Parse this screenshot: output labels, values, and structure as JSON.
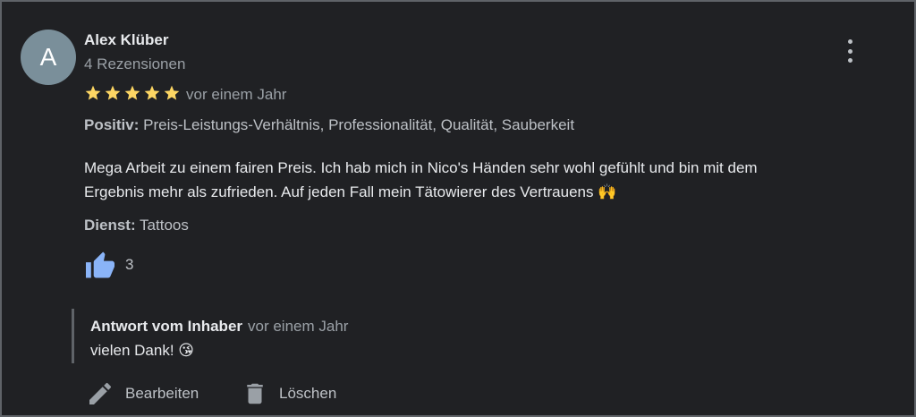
{
  "review": {
    "avatar_letter": "A",
    "author_name": "Alex Klüber",
    "author_reviews": "4 Rezensionen",
    "rating": 5,
    "rating_max": 5,
    "time": "vor einem Jahr",
    "positive_label": "Positiv:",
    "positive_text": "Preis-Leistungs-Verhältnis, Professionalität, Qualität, Sauberkeit",
    "text_line1": "Mega Arbeit zu einem fairen Preis. Ich hab mich in Nico's Händen sehr wohl gefühlt und bin mit dem",
    "text_line2": "Ergebnis mehr als zufrieden. Auf jeden Fall mein Tätowierer des Vertrauens",
    "text_emoji": "🙌",
    "service_label": "Dienst:",
    "service_value": "Tattoos",
    "likes": "3",
    "colors": {
      "background": "#202124",
      "star": "#fdd663",
      "like": "#8ab4f8",
      "avatar": "#7a8f9a"
    }
  },
  "reply": {
    "heading": "Antwort vom Inhaber",
    "time": "vor einem Jahr",
    "text": "vielen Dank!",
    "emoji": "😘"
  },
  "actions": {
    "edit_label": "Bearbeiten",
    "delete_label": "Löschen"
  },
  "icons": [
    "more-vert-icon",
    "star-icon",
    "thumbs-up-icon",
    "pencil-icon",
    "trash-icon"
  ]
}
